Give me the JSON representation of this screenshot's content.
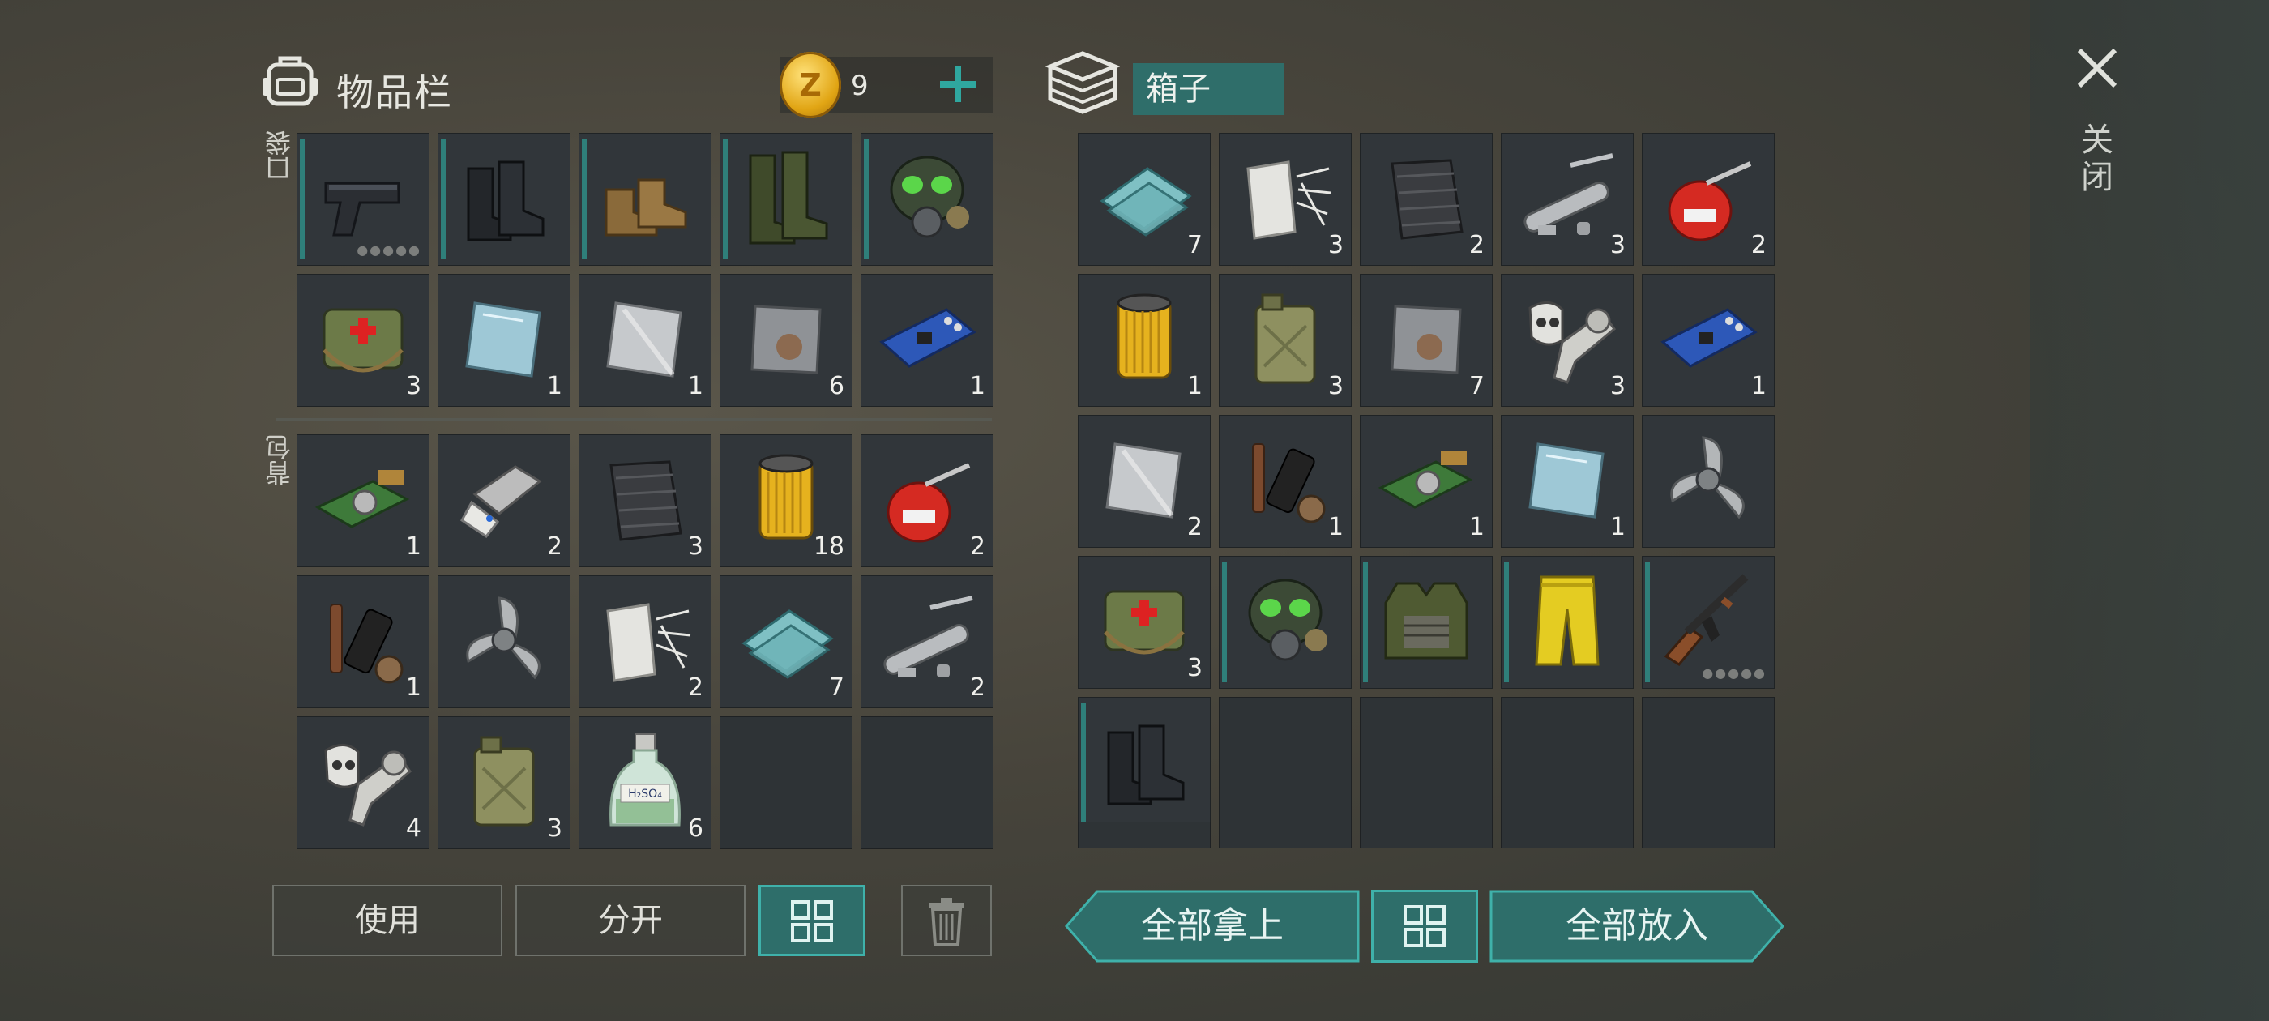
{
  "header": {
    "inventory_title": "物品栏",
    "coin_count": "9",
    "coin_symbol": "Z",
    "box_label": "箱子",
    "close_label": "关闭"
  },
  "sections": {
    "pocket_label": "口袋",
    "backpack_label": "背包"
  },
  "pocket_items": [
    {
      "icon": "pistol-icon",
      "count": "",
      "dots": "●●●●●",
      "equipped": true
    },
    {
      "icon": "black-boots-icon",
      "count": "",
      "equipped": true
    },
    {
      "icon": "brown-boots-icon",
      "count": "",
      "equipped": true
    },
    {
      "icon": "rubber-boots-icon",
      "count": "",
      "equipped": true
    },
    {
      "icon": "gas-mask-icon",
      "count": "",
      "equipped": true
    },
    {
      "icon": "medkit-bag-icon",
      "count": "3"
    },
    {
      "icon": "glass-plate-icon",
      "count": "1"
    },
    {
      "icon": "steel-plate-icon",
      "count": "1"
    },
    {
      "icon": "rusty-plate-icon",
      "count": "6"
    },
    {
      "icon": "circuit-board-icon",
      "count": "1"
    }
  ],
  "backpack_items": [
    {
      "icon": "camera-module-icon",
      "count": "1"
    },
    {
      "icon": "key-card-icon",
      "count": "2"
    },
    {
      "icon": "carbon-fabric-icon",
      "count": "3"
    },
    {
      "icon": "oil-filter-icon",
      "count": "18"
    },
    {
      "icon": "oil-can-icon",
      "count": "2"
    },
    {
      "icon": "gun-parts-icon",
      "count": "1"
    },
    {
      "icon": "propeller-icon",
      "count": ""
    },
    {
      "icon": "fiberglass-icon",
      "count": "2"
    },
    {
      "icon": "glass-panes-icon",
      "count": "7"
    },
    {
      "icon": "metal-pipes-icon",
      "count": "2"
    },
    {
      "icon": "engine-parts-icon",
      "count": "4"
    },
    {
      "icon": "jerry-can-icon",
      "count": "3"
    },
    {
      "icon": "chemical-bottle-icon",
      "count": "6",
      "bottle_label": "H₂SO₄"
    },
    {
      "icon": "",
      "count": ""
    },
    {
      "icon": "",
      "count": ""
    }
  ],
  "box_items": [
    {
      "icon": "glass-panes-icon",
      "count": "7"
    },
    {
      "icon": "fiberglass-icon",
      "count": "3"
    },
    {
      "icon": "carbon-fabric-icon",
      "count": "2"
    },
    {
      "icon": "metal-pipes-icon",
      "count": "3"
    },
    {
      "icon": "oil-can-icon",
      "count": "2"
    },
    {
      "icon": "oil-filter-icon",
      "count": "1"
    },
    {
      "icon": "jerry-can-icon",
      "count": "3"
    },
    {
      "icon": "rusty-plate-icon",
      "count": "7"
    },
    {
      "icon": "engine-parts-icon",
      "count": "3"
    },
    {
      "icon": "circuit-board-icon",
      "count": "1"
    },
    {
      "icon": "steel-plate-icon",
      "count": "2"
    },
    {
      "icon": "gun-parts-icon",
      "count": "1"
    },
    {
      "icon": "camera-module-icon",
      "count": "1"
    },
    {
      "icon": "glass-plate-icon",
      "count": "1"
    },
    {
      "icon": "propeller-icon",
      "count": ""
    },
    {
      "icon": "medkit-bag-icon",
      "count": "3"
    },
    {
      "icon": "gas-mask-icon",
      "count": "",
      "equipped": true
    },
    {
      "icon": "tactical-vest-icon",
      "count": "",
      "equipped": true
    },
    {
      "icon": "yellow-pants-icon",
      "count": "",
      "equipped": true
    },
    {
      "icon": "assault-rifle-icon",
      "count": "",
      "dots": "●●●●●",
      "equipped": true
    },
    {
      "icon": "black-boots-icon",
      "count": "",
      "equipped": true
    },
    {
      "icon": "",
      "count": ""
    },
    {
      "icon": "",
      "count": ""
    },
    {
      "icon": "",
      "count": ""
    },
    {
      "icon": "",
      "count": ""
    }
  ],
  "buttons": {
    "use": "使用",
    "split": "分开",
    "take_all": "全部拿上",
    "put_all": "全部放入"
  },
  "colors": {
    "accent_teal": "#2f7f7a",
    "button_teal": "#2e6e6a",
    "coin_gold": "#e1a514"
  }
}
